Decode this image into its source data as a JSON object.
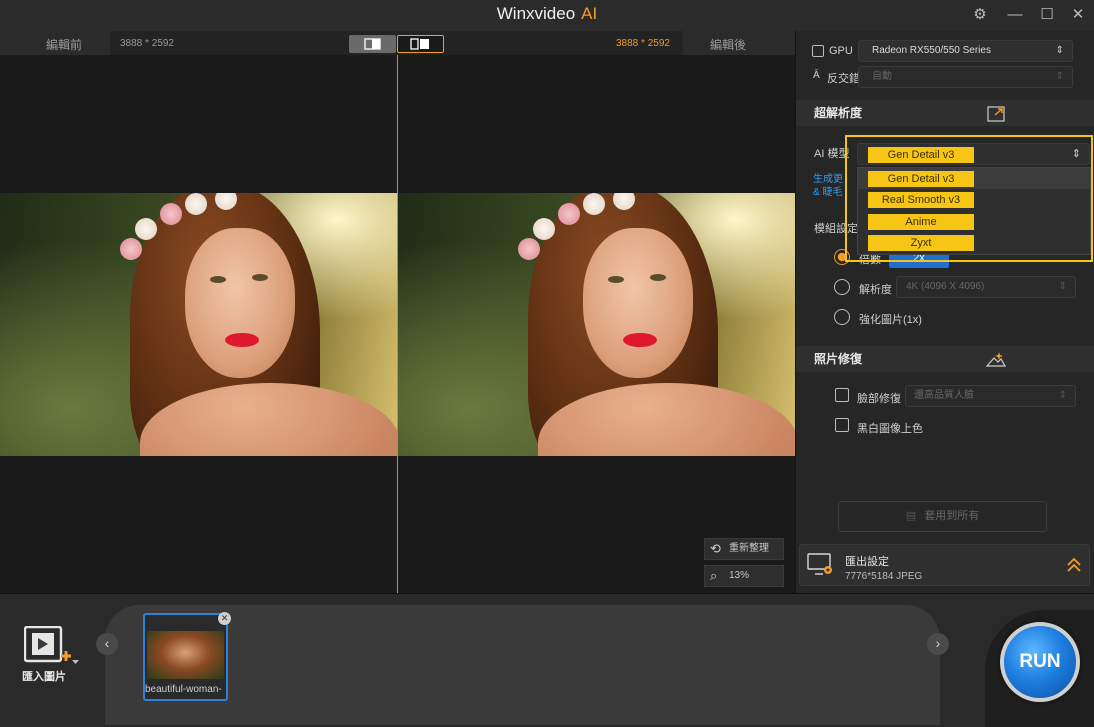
{
  "window": {
    "title": "Winxvideo",
    "title_accent": "AI",
    "controls": {
      "settings": "⚙",
      "minimize": "—",
      "maximize": "☐",
      "close": "✕"
    }
  },
  "compare": {
    "before_label": "編輯前",
    "before_dims": "3888 * 2592",
    "after_dims": "3888 * 2592",
    "after_label": "編輯後"
  },
  "preview": {
    "reset_label": "重新整理",
    "zoom_label": "13%"
  },
  "gpu": {
    "label": "GPU",
    "value": "Radeon RX550/550 Series"
  },
  "antialias": {
    "label": "反交錯",
    "value": "自動"
  },
  "superres": {
    "title": "超解析度",
    "ai_model_label": "AI 模型",
    "selected_model": "Gen Detail v3",
    "hint_line1": "生成更",
    "hint_line2": "& 睫毛",
    "module_label": "模組設定",
    "scale_label": "倍數",
    "scale_value": "2x",
    "resolution_label": "解析度",
    "resolution_value": "4K (4096 X 4096)",
    "enhance_label": "強化圖片(1x)",
    "models": [
      "Gen Detail v3",
      "Real Smooth v3",
      "Anime",
      "Zyxt"
    ]
  },
  "photo_repair": {
    "title": "照片修復",
    "face_label": "臉部修復",
    "face_value": "還高品質人臉",
    "colorize_label": "黑白圖像上色"
  },
  "apply_all_label": "套用到所有",
  "export": {
    "title": "匯出設定",
    "details": "7776*5184  JPEG"
  },
  "bottom": {
    "import_label": "匯入圖片",
    "thumb_caption": "beautiful-woman-",
    "run_label": "RUN"
  },
  "colors": {
    "accent": "#f39c27",
    "highlight": "#f7c514",
    "run_blue": "#1f7fe0"
  }
}
